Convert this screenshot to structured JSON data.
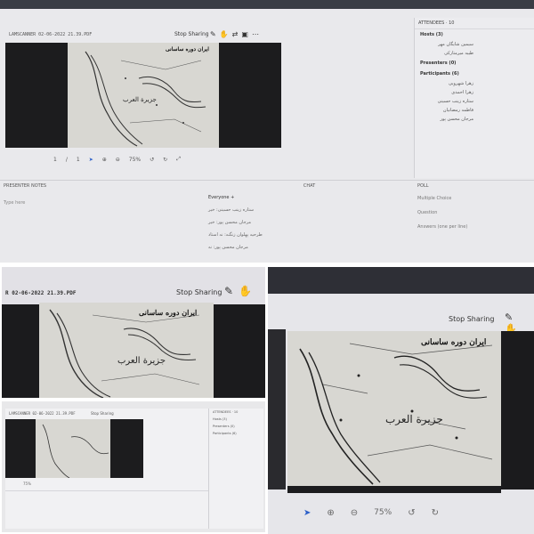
{
  "file_name_full": "LAMSCANNER 02-06-2022 21.39.PDF",
  "file_name_short": "R 02-06-2022 21.39.PDF",
  "stop_sharing": "Stop Sharing",
  "map": {
    "title": "ایران دوره ساسانی",
    "region_label": "جزیرة العرب"
  },
  "viewer": {
    "page_current": "1",
    "page_sep": "/",
    "page_total": "1",
    "zoom": "75%"
  },
  "attendees": {
    "header": "ATTENDEES · 10",
    "hosts_label": "Hosts (3)",
    "hosts": [
      "سیمین شایگان مهر",
      "طیبه میرمتارکی"
    ],
    "presenters_label": "Presenters (0)",
    "participants_label": "Participants (6)",
    "participants": [
      "زهرا شهرویی",
      "زهرا احمدی",
      "ستاره زینب حسینی",
      "فاطمه رمضانیان",
      "مرجان محسن پور"
    ]
  },
  "notes": {
    "label": "PRESENTER NOTES",
    "placeholder": "Type here"
  },
  "chat": {
    "label": "CHAT",
    "everyone": "Everyone",
    "add": "+",
    "messages": [
      "ستاره زینب حسینی: خیر",
      "مرجان محسن پور: خیر",
      "طرحیه پهلوان زنگنه: نه استاد",
      "مرجان محسن پور: نه"
    ]
  },
  "poll": {
    "label": "POLL",
    "type": "Multiple Choice",
    "question": "Question",
    "answers": "Answers (one per line)"
  },
  "icons": {
    "pen": "pen-icon",
    "hand": "hand-icon",
    "pointer": "pointer-icon",
    "zoom_in": "zoom-in-icon",
    "zoom_out": "zoom-out-icon",
    "undo": "undo-icon",
    "redo": "redo-icon",
    "more": "more-icon"
  }
}
